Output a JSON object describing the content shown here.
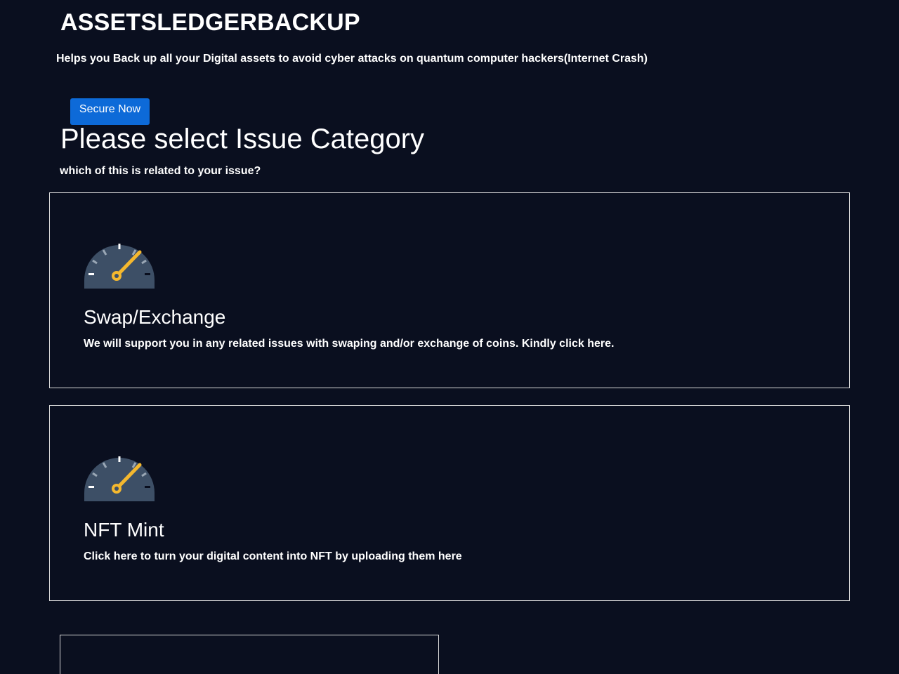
{
  "header": {
    "title": "ASSETSLEDGERBACKUP",
    "tagline": "Helps you Back up all your Digital assets to avoid cyber attacks on quantum computer hackers(Internet Crash)",
    "cta_label": "Secure Now"
  },
  "section": {
    "title": "Please select Issue Category",
    "subtitle": "which of this is related to your issue?"
  },
  "categories": [
    {
      "title": "Swap/Exchange",
      "description": "We will support you in any related issues with swaping and/or exchange of coins. Kindly click here.",
      "icon": "speedometer-icon"
    },
    {
      "title": "NFT Mint",
      "description": "Click here to turn your digital content into NFT by uploading them here",
      "icon": "speedometer-icon"
    }
  ],
  "colors": {
    "background": "#0a0f1f",
    "button": "#0d6ad8",
    "card_border": "#d8d8d8",
    "gauge_body": "#3d4f66",
    "gauge_needle": "#f5b82e"
  }
}
